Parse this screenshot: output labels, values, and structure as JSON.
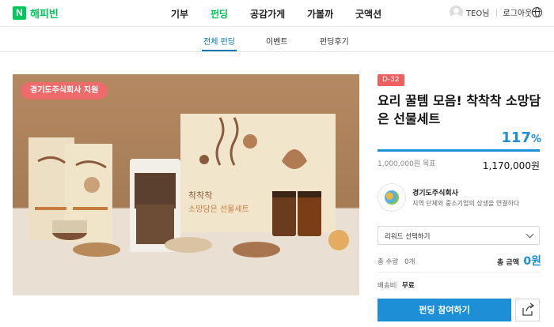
{
  "header": {
    "logo_mark": "N",
    "logo_text": "해피빈",
    "menu": [
      "기부",
      "펀딩",
      "공감가게",
      "가볼까",
      "굿액션"
    ],
    "active_menu": "펀딩",
    "user_name": "TEO님",
    "logout": "로그아웃"
  },
  "subnav": {
    "tabs": [
      "전체 펀딩",
      "이벤트",
      "펀딩후기"
    ],
    "active_tab": "전체 펀딩"
  },
  "hero": {
    "badge": "경기도주식회사 지원",
    "box_label_line1": "착착착",
    "box_label_line2": "소망담은 선물세트"
  },
  "project": {
    "dday": "D-32",
    "title": "요리 꿀템 모음! 착착착 소망담은 선물세트",
    "percent_value": "117",
    "percent_unit": "%",
    "progress_fraction": 1.0,
    "goal_label": "1,000,000원 목표",
    "raised_amount": "1,170,000원"
  },
  "company": {
    "name": "경기도주식회사",
    "description": "지역 단체와 중소기업의 상생을 연결하다"
  },
  "purchase": {
    "reward_select_placeholder": "리워드 선택하기",
    "quantity_label": "총 수량",
    "quantity_value": "0개",
    "total_label": "총 금액",
    "total_value": "0원",
    "shipping_label": "배송비",
    "shipping_value": "무료",
    "fund_button": "펀딩 참여하기"
  },
  "colors": {
    "brand_green": "#03c75a",
    "accent_blue": "#1d8fd7",
    "badge_red": "#ee6b6b"
  }
}
